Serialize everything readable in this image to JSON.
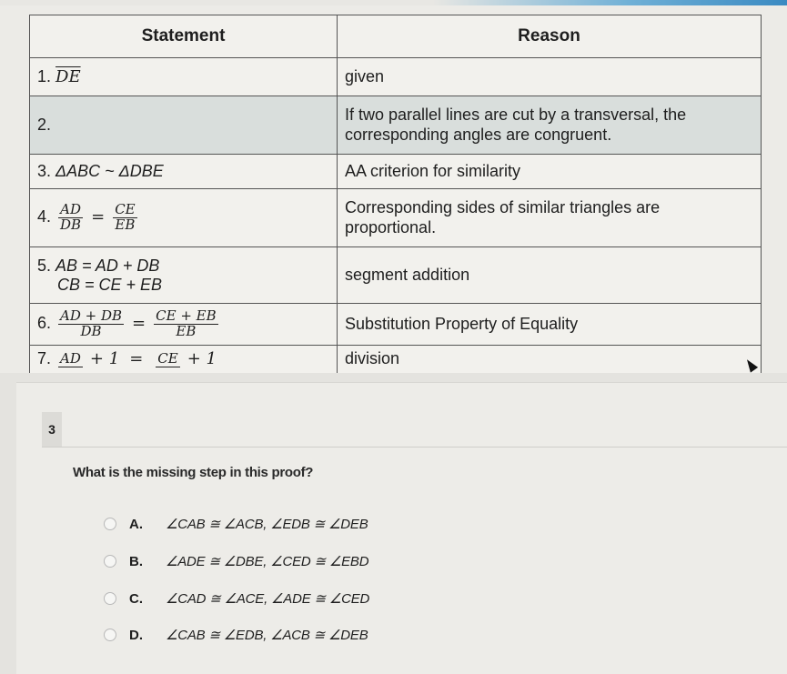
{
  "proof_table": {
    "headers": {
      "statement": "Statement",
      "reason": "Reason"
    },
    "rows": [
      {
        "num": "1.",
        "statement": "DE",
        "reason": "given"
      },
      {
        "num": "2.",
        "statement": "",
        "reason": "If two parallel lines are cut by a transversal, the corresponding angles are congruent."
      },
      {
        "num": "3.",
        "statement": "ΔABC ~ ΔDBE",
        "reason": "AA criterion for similarity"
      },
      {
        "num": "4.",
        "statement": {
          "left_num": "AD",
          "left_den": "DB",
          "right_num": "CE",
          "right_den": "EB"
        },
        "reason": "Corresponding sides of similar triangles are proportional."
      },
      {
        "num": "5.",
        "statement": {
          "line1": "AB = AD + DB",
          "line2": "CB = CE + EB"
        },
        "reason": "segment addition"
      },
      {
        "num": "6.",
        "statement": {
          "left_num": "AD + DB",
          "left_den": "DB",
          "right_num": "CE + EB",
          "right_den": "EB"
        },
        "reason": "Substitution Property of Equality"
      },
      {
        "num": "7.",
        "statement": {
          "left_num": "AD",
          "right_num": "CE",
          "plus": "+ 1"
        },
        "reason": "division"
      }
    ]
  },
  "question": {
    "number": "3",
    "prompt": "What is the missing step in this proof?",
    "choices": [
      {
        "letter": "A.",
        "text": "∠CAB ≅ ∠ACB, ∠EDB ≅ ∠DEB"
      },
      {
        "letter": "B.",
        "text": "∠ADE ≅ ∠DBE, ∠CED ≅ ∠EBD"
      },
      {
        "letter": "C.",
        "text": "∠CAD ≅ ∠ACE, ∠ADE ≅ ∠CED"
      },
      {
        "letter": "D.",
        "text": "∠CAB ≅ ∠EDB, ∠ACB ≅ ∠DEB"
      }
    ]
  },
  "colors": {
    "highlight_row": "#d9dedc",
    "accent_bar": "#3a8ac2"
  }
}
